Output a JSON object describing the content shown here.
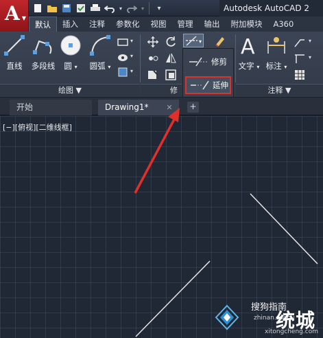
{
  "window": {
    "title": "Autodesk AutoCAD 2",
    "app_logo_letter": "A"
  },
  "ribbon_tabs": [
    "默认",
    "插入",
    "注释",
    "参数化",
    "视图",
    "管理",
    "输出",
    "附加模块",
    "A360"
  ],
  "ribbon": {
    "draw_tools": {
      "line": "直线",
      "polyline": "多段线",
      "circle": "圆",
      "arc": "圆弧"
    },
    "annotation_tools": {
      "text": "文字",
      "dimension": "标注"
    },
    "panels": {
      "draw": "绘图 ▼",
      "modify": "修",
      "annotation": "注释 ▼"
    }
  },
  "flyout": {
    "trim": "修剪",
    "extend": "延伸"
  },
  "doc_tabs": {
    "start": "开始",
    "drawing": "Drawing1*",
    "close": "✕",
    "add": "+"
  },
  "canvas": {
    "viewport_label": "[−][俯视][二维线框]"
  },
  "watermark": {
    "top_text": "搜狗指南",
    "big_text": "统城",
    "url1": "zhinan.sogou",
    "url2": "xitongcheng.com"
  },
  "colors": {
    "highlight_box": "#e0302c",
    "arrow": "#e0302c",
    "canvas_bg": "#212835",
    "line_color": "#e6e6e6"
  }
}
